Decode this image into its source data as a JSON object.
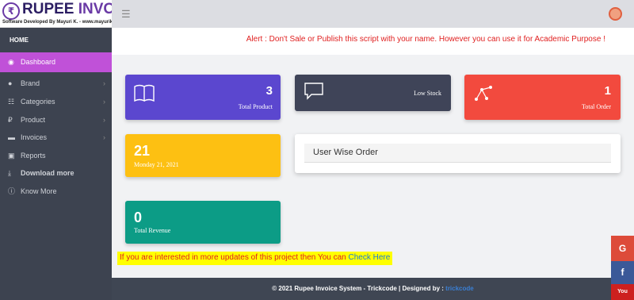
{
  "brand": {
    "logo_mark": "₹",
    "name_part1": "RUPEE ",
    "name_part2": "INVOICE",
    "tagline": "Software Developed By Mayuri K. - www.mayurik.com"
  },
  "sidebar": {
    "section_label": "HOME",
    "active_item": "Dashboard",
    "items": [
      {
        "label": "Brand",
        "icon": "apple-icon",
        "has_chevron": true
      },
      {
        "label": "Categories",
        "icon": "list-icon",
        "has_chevron": true
      },
      {
        "label": "Product",
        "icon": "rupee-icon",
        "has_chevron": true
      },
      {
        "label": "Invoices",
        "icon": "cart-icon",
        "has_chevron": true
      },
      {
        "label": "Reports",
        "icon": "bus-icon",
        "has_chevron": false
      },
      {
        "label": "Download more",
        "icon": "download-icon",
        "has_chevron": false
      },
      {
        "label": "Know More",
        "icon": "info-icon",
        "has_chevron": false
      }
    ]
  },
  "alert": "Alert : Don't Sale or Publish this script with your name. However you can use it for Academic Purpose !",
  "cards": {
    "total_product": {
      "value": "3",
      "label": "Total Product",
      "color": "#5b47cf"
    },
    "low_stock": {
      "label": "Low Stock",
      "color": "#3f4458"
    },
    "total_order": {
      "value": "1",
      "label": "Total Order",
      "color": "#f24a3e"
    },
    "date_card": {
      "value": "21",
      "label": "Monday 21, 2021",
      "color": "#fdc012"
    },
    "total_revenue": {
      "value": "0",
      "label": "Total Revenue",
      "color": "#0c9c86"
    }
  },
  "panel": {
    "title": "User Wise Order"
  },
  "promo": {
    "text": "If you are interested in more updates of this project then You can ",
    "link": "Check Here"
  },
  "footer": {
    "text": "© 2021 Rupee Invoice System - Trickcode | Designed by : ",
    "brand": "trickcode"
  },
  "social": {
    "google": "G",
    "facebook": "f",
    "youtube": "You"
  }
}
